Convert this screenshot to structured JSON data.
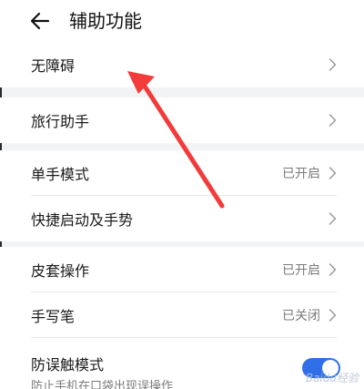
{
  "header": {
    "title": "辅助功能"
  },
  "groups": [
    {
      "items": [
        {
          "label": "无障碍",
          "status": ""
        }
      ]
    },
    {
      "items": [
        {
          "label": "旅行助手",
          "status": ""
        }
      ]
    },
    {
      "items": [
        {
          "label": "单手模式",
          "status": "已开启"
        },
        {
          "label": "快捷启动及手势",
          "status": ""
        }
      ]
    },
    {
      "items": [
        {
          "label": "皮套操作",
          "status": "已开启"
        },
        {
          "label": "手写笔",
          "status": "已关闭"
        },
        {
          "label": "防误触模式",
          "sublabel": "防止手机在口袋出现误操作",
          "toggle_on": true
        }
      ]
    }
  ],
  "colors": {
    "accent": "#2f6fe8",
    "annotation_arrow": "#f23b3b"
  },
  "icons": {
    "back": "arrow-left-icon",
    "chevron": "chevron-right-icon"
  },
  "watermark": "Baidu经验"
}
